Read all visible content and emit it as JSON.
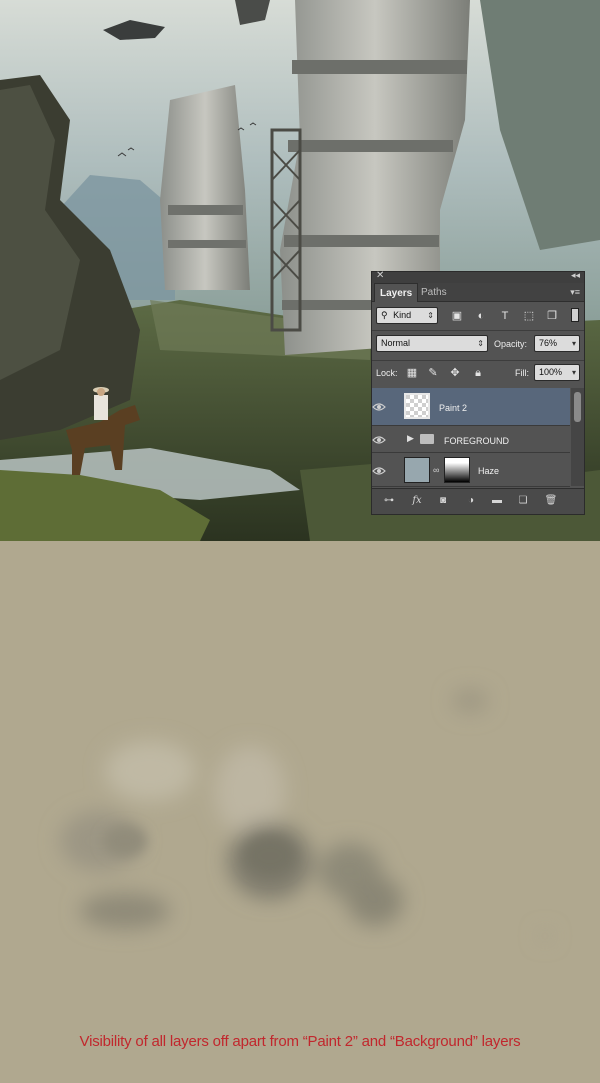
{
  "panel": {
    "tabs": {
      "layers": "Layers",
      "paths": "Paths"
    },
    "filter": {
      "kind_label": "Kind"
    },
    "blend_mode": "Normal",
    "opacity_label": "Opacity:",
    "opacity_value": "76%",
    "lock_label": "Lock:",
    "fill_label": "Fill:",
    "fill_value": "100%",
    "layers": [
      {
        "name": "Paint 2",
        "selected": true,
        "type": "pixel"
      },
      {
        "name": "FOREGROUND",
        "selected": false,
        "type": "group"
      },
      {
        "name": "Haze",
        "selected": false,
        "type": "masked"
      }
    ],
    "bottom_icons": [
      "link-icon",
      "fx-icon",
      "mask-icon",
      "adjustment-icon",
      "folder-icon",
      "new-layer-icon",
      "trash-icon"
    ],
    "fx_label": "fx"
  },
  "caption": "Visibility of all layers off apart from “Paint 2” and  “Background” layers",
  "colors": {
    "paint_background": "#b0a88f",
    "caption_red": "#c1272d",
    "panel_bg": "#535353",
    "selected_row": "#58677b"
  }
}
